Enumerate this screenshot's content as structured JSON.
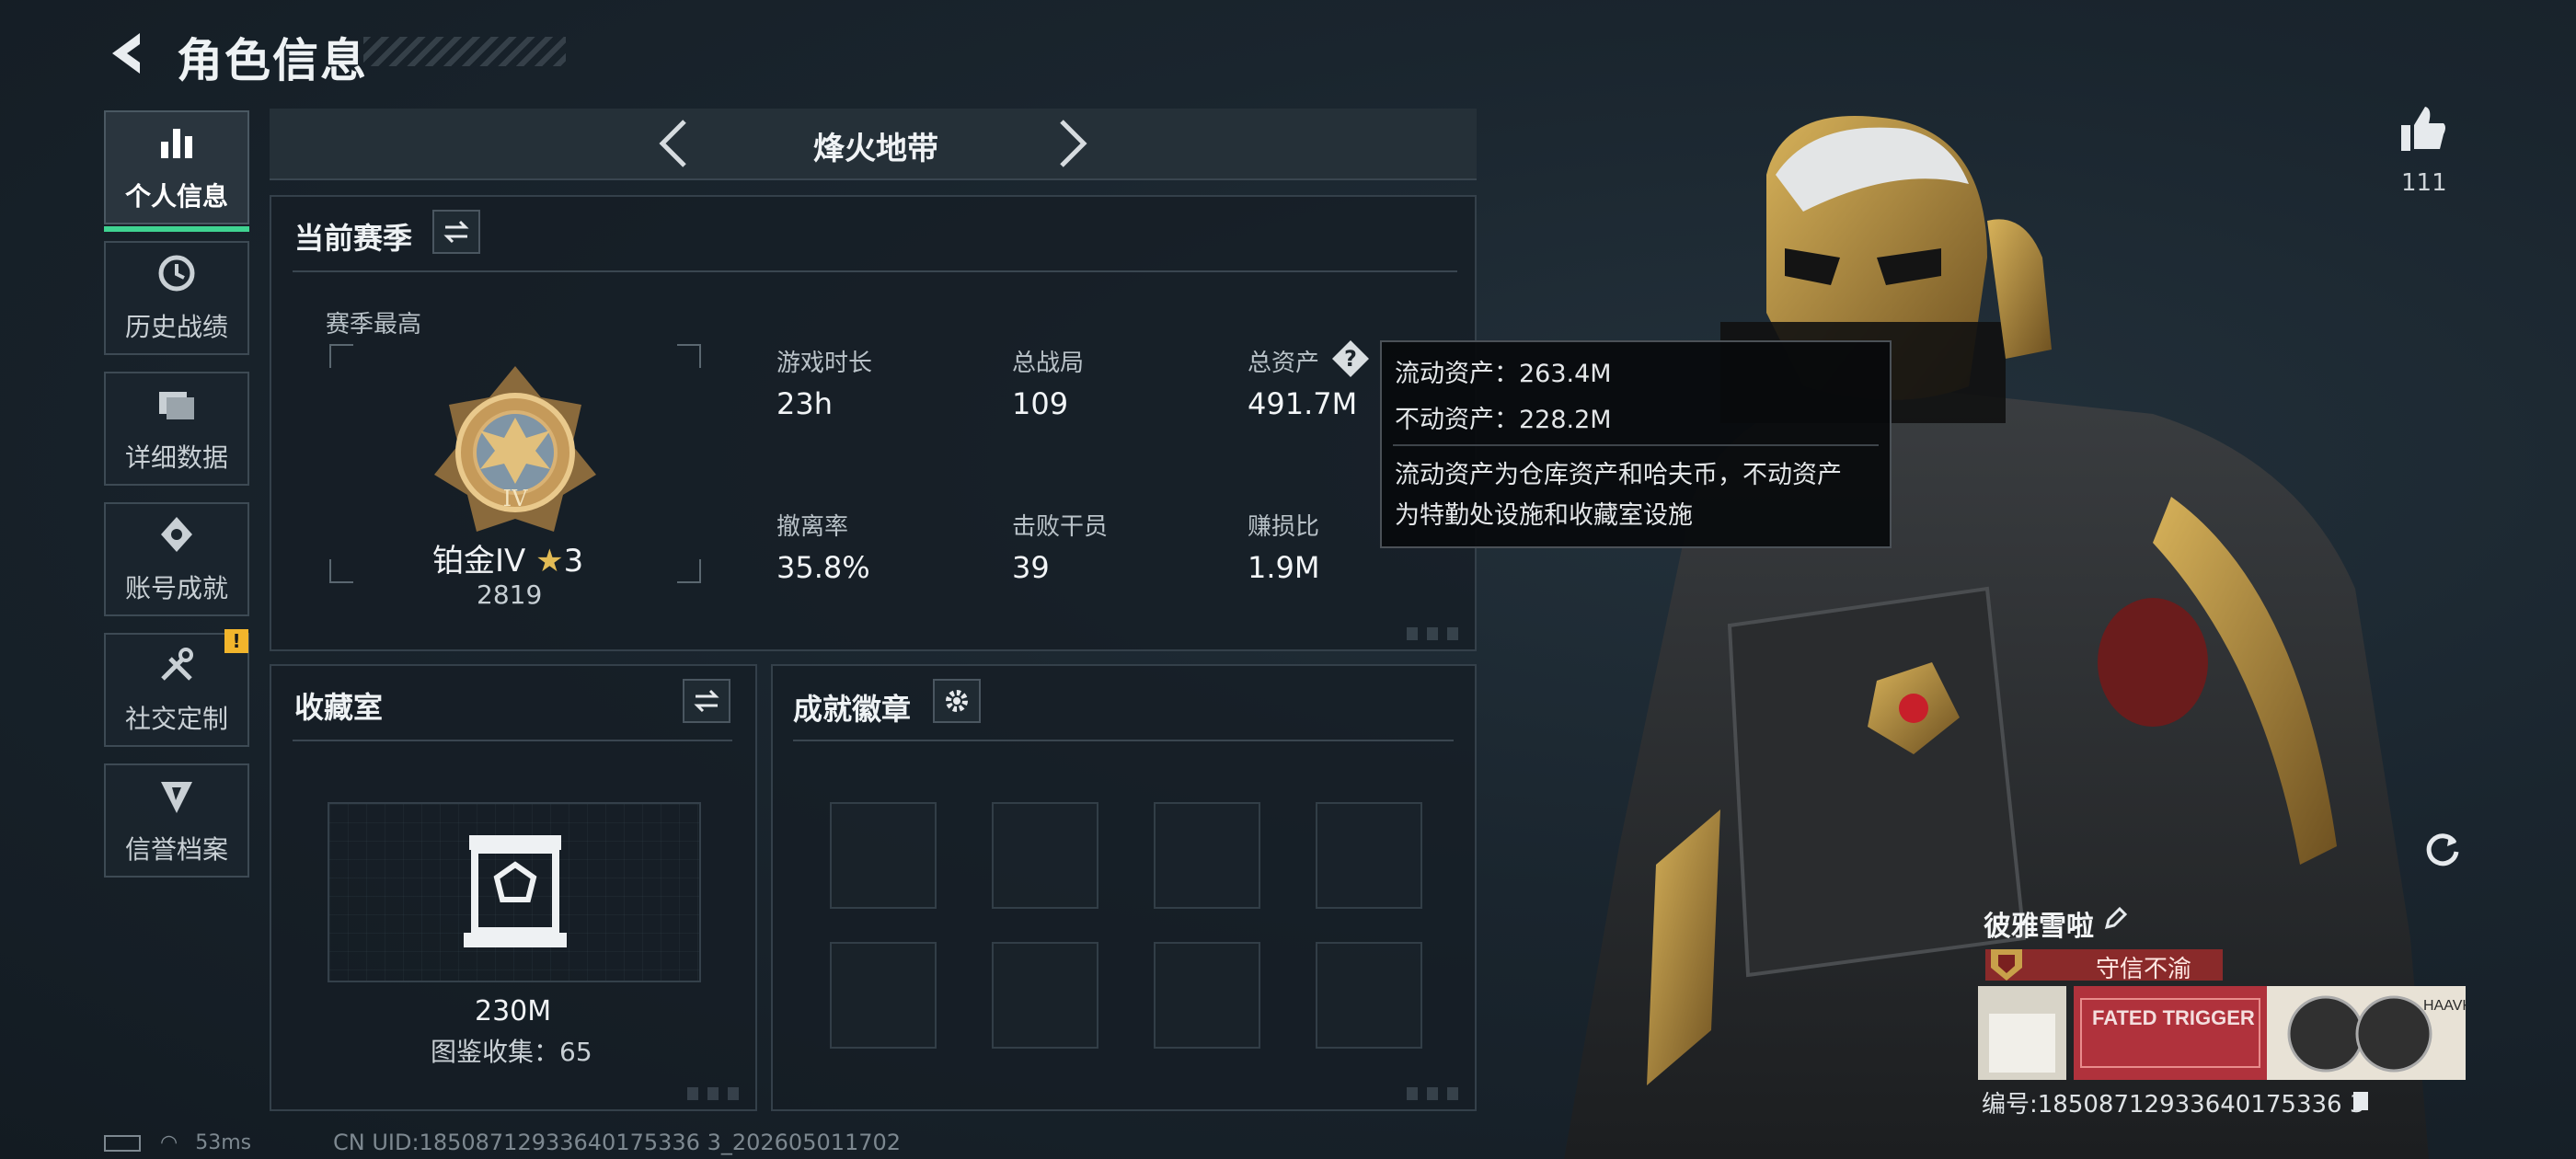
{
  "header": {
    "title": "角色信息"
  },
  "nav": [
    {
      "label": "个人信息",
      "icon": "bar-chart-icon",
      "active": true
    },
    {
      "label": "历史战绩",
      "icon": "clock-icon"
    },
    {
      "label": "详细数据",
      "icon": "folder-icon"
    },
    {
      "label": "账号成就",
      "icon": "achievement-icon"
    },
    {
      "label": "社交定制",
      "icon": "tools-icon",
      "alert": "!"
    },
    {
      "label": "信誉档案",
      "icon": "shield-icon"
    }
  ],
  "mode": {
    "title": "烽火地带"
  },
  "season": {
    "title": "当前赛季",
    "best_label": "赛季最高",
    "rank_name": "铂金IV",
    "rank_stars": "3",
    "rank_score": "2819",
    "medal_roman": "IV",
    "stats": [
      {
        "label": "游戏时长",
        "value": "23h"
      },
      {
        "label": "总战局",
        "value": "109"
      },
      {
        "label": "总资产",
        "value": "491.7M"
      },
      {
        "label": "撤离率",
        "value": "35.8%"
      },
      {
        "label": "击败干员",
        "value": "39"
      },
      {
        "label": "赚损比",
        "value": "1.9M"
      }
    ],
    "help_glyph": "?"
  },
  "tooltip": {
    "liquid": "流动资产：263.4M",
    "fixed": "不动资产：228.2M",
    "desc_line1": "流动资产为仓库资产和哈夫币，不动资产",
    "desc_line2": "为特勤处设施和收藏室设施"
  },
  "collection": {
    "title": "收藏室",
    "value": "230M",
    "catalog": "图鉴收集：65"
  },
  "badges": {
    "title": "成就徽章",
    "slots": 8
  },
  "status": {
    "ping": "53ms",
    "uid": "CN UID:18508712933640175336 3_202605011702"
  },
  "character": {
    "likes": "111"
  },
  "player": {
    "name": "彼雅雪啦",
    "title": "守信不渝",
    "card_text": "FATED TRIGGER",
    "card_side": "HAAVK",
    "id": "编号:18508712933640175336 3"
  },
  "colors": {
    "accent": "#3fd391",
    "warning": "#f2b52c",
    "title_red": "#8a2a2a",
    "gold": "#c8a04a"
  }
}
